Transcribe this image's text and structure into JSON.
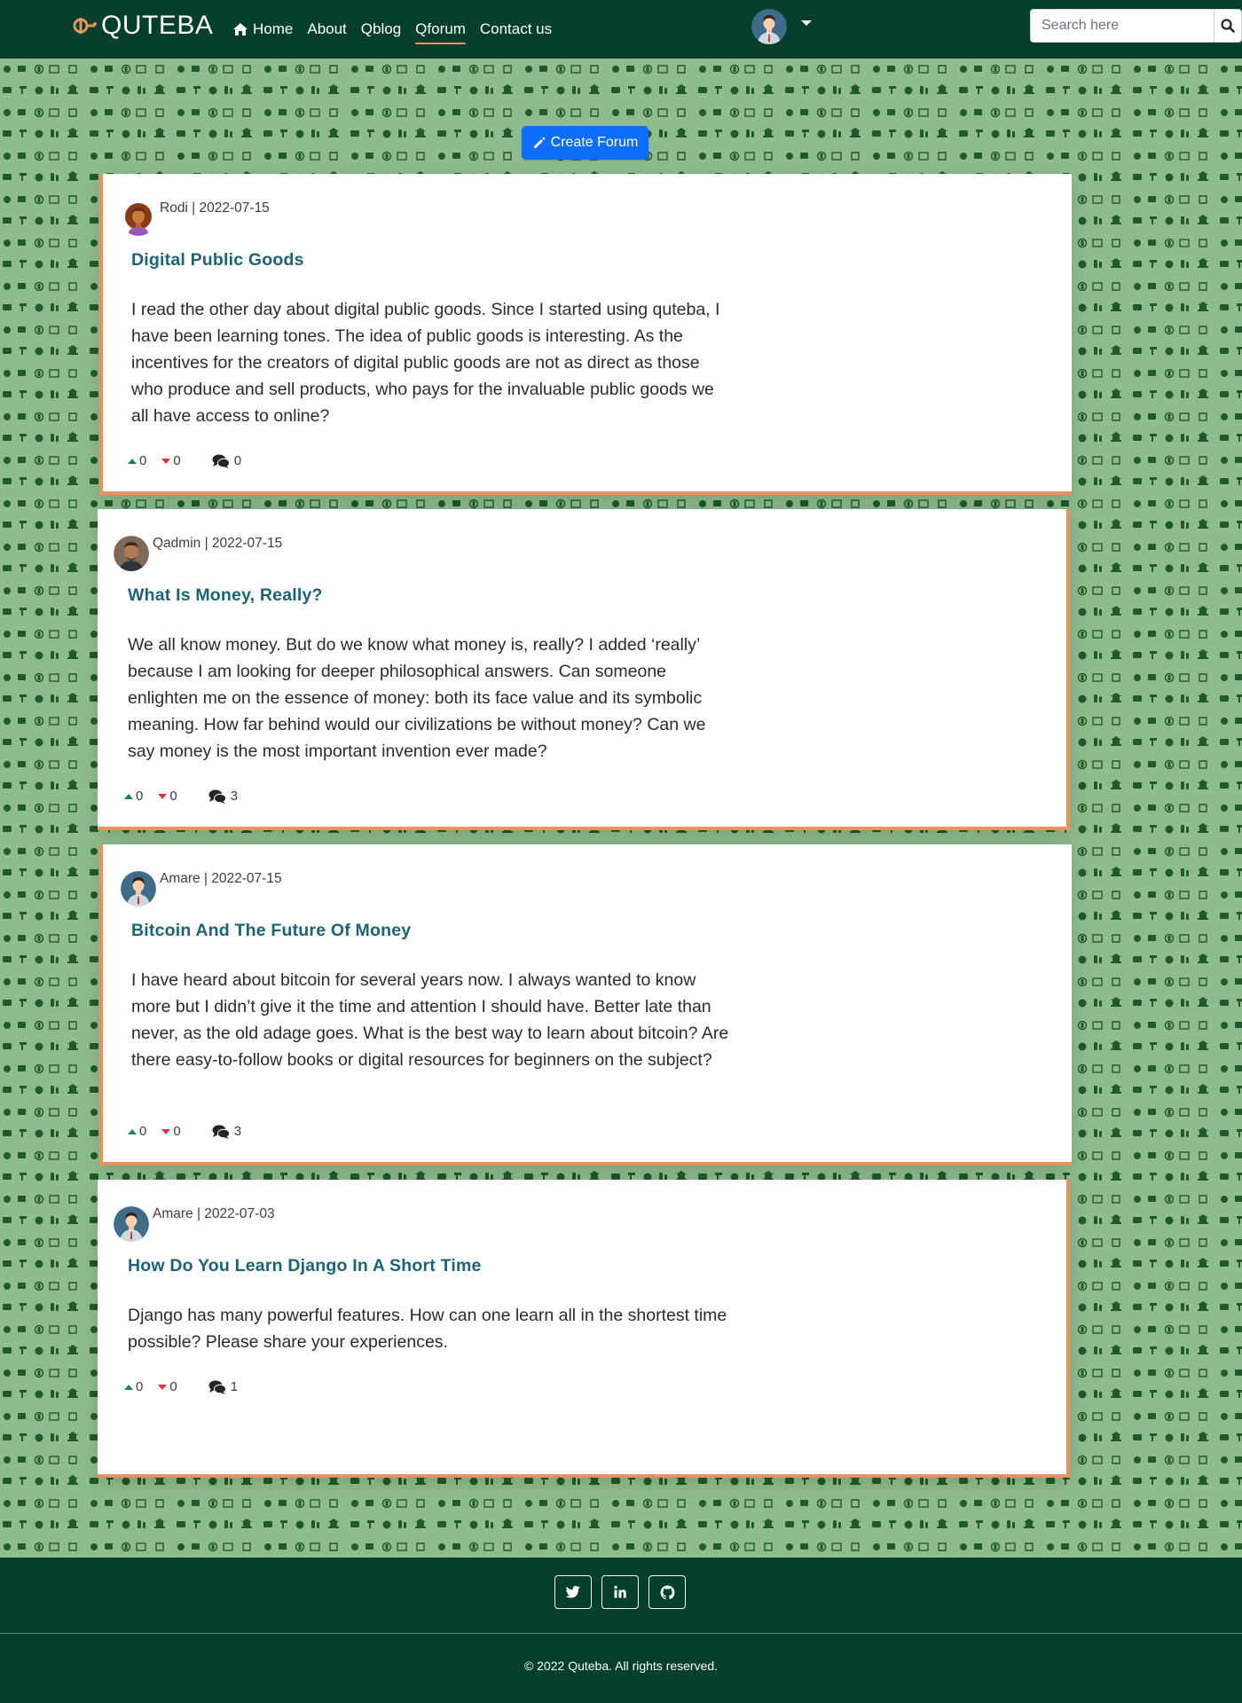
{
  "brand": {
    "name": "QUTEBA"
  },
  "nav": {
    "links": [
      {
        "label": "Home"
      },
      {
        "label": "About"
      },
      {
        "label": "Qblog"
      },
      {
        "label": "Qforum"
      },
      {
        "label": "Contact us"
      }
    ],
    "active": "Qforum"
  },
  "search": {
    "placeholder": "Search here",
    "value": ""
  },
  "create_button": {
    "label": "Create Forum"
  },
  "posts": [
    {
      "author": "Rodi",
      "date": "2022-07-15",
      "meta": "Rodi | 2022-07-15",
      "title": "Digital Public Goods",
      "body": "I read the other day about digital public goods. Since I started using quteba, I have been learning tones. The idea of public goods is interesting. As the incentives for the creators of digital public goods are not as direct as those who produce and sell products, who pays for the invaluable public goods we all have access to online?",
      "upvotes": "0",
      "downvotes": "0",
      "comments": "0"
    },
    {
      "author": "Qadmin",
      "date": "2022-07-15",
      "meta": "Qadmin | 2022-07-15",
      "title": "What Is Money, Really?",
      "body": "We all know money. But do we know what money is, really? I added ‘really’ because I am looking for deeper philosophical answers. Can someone enlighten me on the essence of money: both its face value and its symbolic meaning. How far behind would our civilizations be without money? Can we say money is the most important invention ever made?",
      "upvotes": "0",
      "downvotes": "0",
      "comments": "3"
    },
    {
      "author": "Amare",
      "date": "2022-07-15",
      "meta": "Amare | 2022-07-15",
      "title": "Bitcoin And The Future Of Money",
      "body": "I have heard about bitcoin for several years now. I always wanted to know more but I didn’t give it the time and attention I should have. Better late than never, as the old adage goes. What is the best way to learn about bitcoin? Are there easy-to-follow books or digital resources for beginners on the subject?",
      "upvotes": "0",
      "downvotes": "0",
      "comments": "3"
    },
    {
      "author": "Amare",
      "date": "2022-07-03",
      "meta": "Amare | 2022-07-03",
      "title": "How Do You Learn Django In A Short Time",
      "body": "Django has many powerful features. How can one learn all in the shortest time possible? Please share your experiences.",
      "upvotes": "0",
      "downvotes": "0",
      "comments": "1"
    }
  ],
  "footer": {
    "social": [
      "twitter-icon",
      "linkedin-icon",
      "github-icon"
    ],
    "copyright": "2022 Quteba. All rights reserved."
  },
  "colors": {
    "nav_bg": "#043f2c",
    "pattern_bg": "#8fbc8f",
    "accent_border": "#e9925e",
    "title_link": "#1b6478",
    "primary_button": "#0d6efd"
  }
}
